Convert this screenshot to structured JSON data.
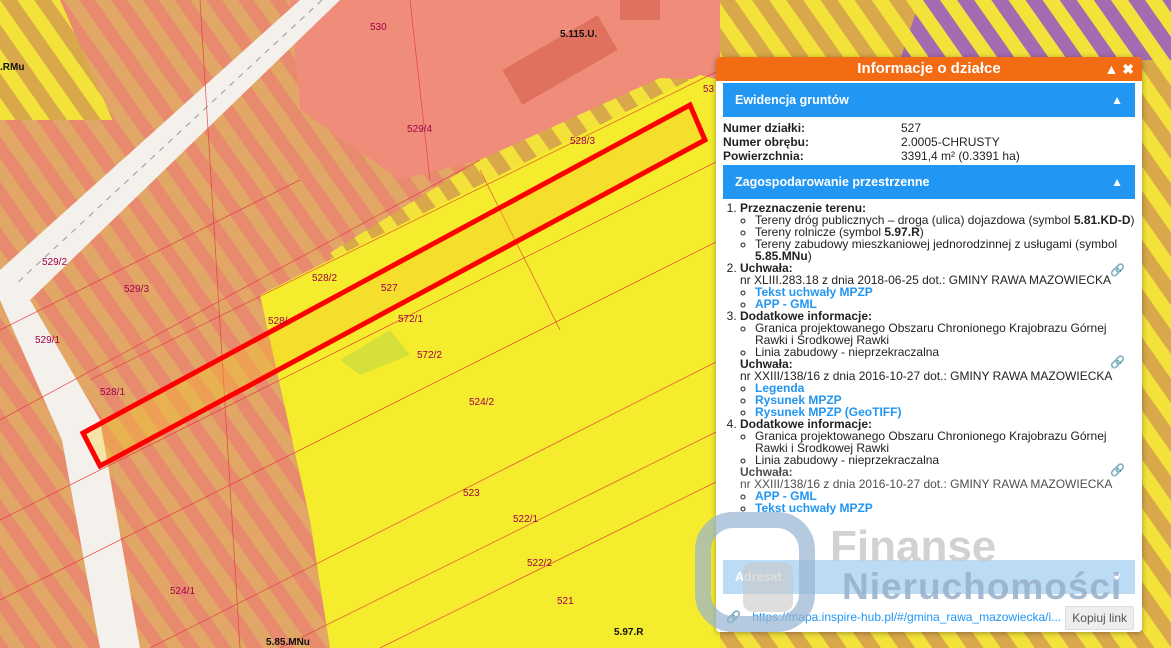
{
  "map": {
    "zone_labels": [
      "5.115.U.",
      ".RMu",
      "5.85.MNu",
      "5.97.R"
    ],
    "parcel_labels": [
      "530",
      "529/4",
      "528/3",
      "529/2",
      "529/3",
      "528/2",
      "527",
      "528/",
      "572/1",
      "572/2",
      "529/1",
      "528/1",
      "524/2",
      "523",
      "522/1",
      "522/2",
      "521",
      "524/1",
      "53"
    ],
    "colors": {
      "hatch_yellow": "#f3e23a",
      "hatch_orange": "#e89a5a",
      "pink_zone": "#f08c7a",
      "highlight": "#ff0000",
      "panel_header": "#f36c13",
      "section_bar": "#2196f3"
    }
  },
  "panel": {
    "title": "Informacje o działce",
    "icons": {
      "collapse": "chevron-up-icon",
      "close": "close-icon"
    },
    "ewidencja": {
      "title": "Ewidencja gruntów",
      "rows": [
        {
          "label": "Numer działki:",
          "value": "527"
        },
        {
          "label": "Numer obrębu:",
          "value": "2.0005-CHRUSTY"
        },
        {
          "label": "Powierzchnia:",
          "value": "3391,4 m² (0.3391 ha)"
        }
      ]
    },
    "zagospodarowanie": {
      "title": "Zagospodarowanie przestrzenne",
      "item1": {
        "heading": "Przeznaczenie terenu:",
        "bullets": [
          {
            "text": "Tereny dróg publicznych – droga (ulica) dojazdowa (symbol ",
            "symbol": "5.81.KD-D",
            "suffix": ")"
          },
          {
            "text": "Tereny rolnicze (symbol ",
            "symbol": "5.97.R",
            "suffix": ")"
          },
          {
            "text": "Tereny zabudowy mieszkaniowej jednorodzinnej z usługami (symbol ",
            "symbol": "5.85.MNu",
            "suffix": ")"
          }
        ]
      },
      "item2": {
        "heading": "Uchwała:",
        "text": "nr XLIII.283.18 z dnia 2018-06-25 dot.: GMINY RAWA MAZOWIECKA",
        "links": [
          "Tekst uchwały MPZP",
          "APP - GML"
        ]
      },
      "item3": {
        "heading": "Dodatkowe informacje:",
        "bullets": [
          "Granica projektowanego Obszaru Chronionego Krajobrazu Górnej Rawki i Środkowej Rawki",
          "Linia zabudowy - nieprzekraczalna"
        ],
        "uchwala_heading": "Uchwała:",
        "uchwala_text": "nr XXIII/138/16 z dnia 2016-10-27 dot.: GMINY RAWA MAZOWIECKA",
        "links": [
          "Legenda",
          "Rysunek MPZP",
          "Rysunek MPZP (GeoTIFF)"
        ]
      },
      "item4": {
        "heading": "Dodatkowe informacje:",
        "bullets": [
          "Granica projektowanego Obszaru Chronionego Krajobrazu Górnej Rawki i Środkowej Rawki",
          "Linia zabudowy - nieprzekraczalna"
        ],
        "uchwala_heading": "Uchwała:",
        "uchwala_text": "nr XXIII/138/16 z dnia 2016-10-27 dot.: GMINY RAWA MAZOWIECKA",
        "links": [
          "APP - GML",
          "Tekst uchwały MPZP"
        ]
      }
    },
    "adresat": {
      "title": "Adresat"
    },
    "footer": {
      "url": "https://mapa.inspire-hub.pl/#/gmina_rawa_mazowiecka/i...",
      "copy_label": "Kopiuj link"
    }
  },
  "watermark": {
    "line1": "Finanse",
    "line2": "Nieruchomości"
  }
}
